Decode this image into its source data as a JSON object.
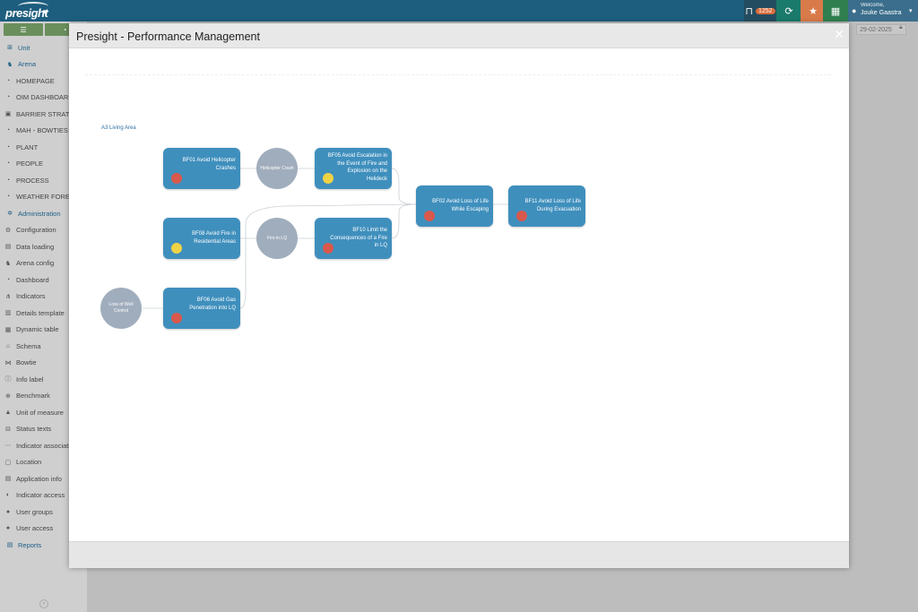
{
  "app": {
    "logo_text": "presight",
    "title": "Presight - Performance Management"
  },
  "topbar": {
    "bookmark_count": "1252",
    "user_welcome": "Welcome,",
    "user_name": "Jouke Gaastra"
  },
  "background": {
    "date": "29-02-2025"
  },
  "sidebar": {
    "items": [
      {
        "label": "Unit",
        "icon": "sitemap-icon",
        "type": "section"
      },
      {
        "label": "Arena",
        "icon": "arena-icon",
        "type": "section"
      },
      {
        "label": "HOMEPAGE",
        "icon": "dashboard-icon",
        "type": "item"
      },
      {
        "label": "OIM DASHBOARD",
        "icon": "dashboard-icon",
        "type": "item"
      },
      {
        "label": "BARRIER STRATEGY",
        "icon": "barrier-icon",
        "type": "item"
      },
      {
        "label": "MAH - BOWTIES",
        "icon": "dashboard-icon",
        "type": "item"
      },
      {
        "label": "PLANT",
        "icon": "dashboard-icon",
        "type": "item"
      },
      {
        "label": "PEOPLE",
        "icon": "dashboard-icon",
        "type": "item"
      },
      {
        "label": "PROCESS",
        "icon": "dashboard-icon",
        "type": "item"
      },
      {
        "label": "WEATHER FORECAST",
        "icon": "dashboard-icon",
        "type": "item"
      },
      {
        "label": "Administration",
        "icon": "gears-icon",
        "type": "section"
      },
      {
        "label": "Configuration",
        "icon": "gear-icon",
        "type": "item"
      },
      {
        "label": "Data loading",
        "icon": "file-icon",
        "type": "item"
      },
      {
        "label": "Arena config",
        "icon": "arena-icon",
        "type": "item"
      },
      {
        "label": "Dashboard",
        "icon": "dashboard-icon",
        "type": "item"
      },
      {
        "label": "Indicators",
        "icon": "indicator-icon",
        "type": "item"
      },
      {
        "label": "Details template",
        "icon": "template-icon",
        "type": "item"
      },
      {
        "label": "Dynamic table",
        "icon": "table-icon",
        "type": "item"
      },
      {
        "label": "Schema",
        "icon": "schema-icon",
        "type": "item"
      },
      {
        "label": "Bowtie",
        "icon": "bowtie-icon",
        "type": "item"
      },
      {
        "label": "Info label",
        "icon": "info-icon",
        "type": "item"
      },
      {
        "label": "Benchmark",
        "icon": "benchmark-icon",
        "type": "item"
      },
      {
        "label": "Unit of measure",
        "icon": "measure-icon",
        "type": "item"
      },
      {
        "label": "Status texts",
        "icon": "status-icon",
        "type": "item"
      },
      {
        "label": "Indicator associations",
        "icon": "association-icon",
        "type": "item"
      },
      {
        "label": "Location",
        "icon": "location-icon",
        "type": "item"
      },
      {
        "label": "Application info",
        "icon": "app-info-icon",
        "type": "item"
      },
      {
        "label": "Indicator access",
        "icon": "access-icon",
        "type": "item"
      },
      {
        "label": "User groups",
        "icon": "users-icon",
        "type": "item"
      },
      {
        "label": "User access",
        "icon": "user-icon",
        "type": "item"
      },
      {
        "label": "Reports",
        "icon": "reports-icon",
        "type": "section"
      }
    ]
  },
  "diagram": {
    "area_label": "A3 Living Area",
    "nodes": [
      {
        "id": "bf01",
        "label": "BF01 Avoid Helicopter Crashes",
        "status": "red"
      },
      {
        "id": "bf05",
        "label": "BF05 Avoid Escalation in the Event of Fire and Explosion on the Helideck",
        "status": "yellow"
      },
      {
        "id": "bf08",
        "label": "BF08 Avoid Fire in Residential Areas",
        "status": "yellow"
      },
      {
        "id": "bf10",
        "label": "BF10 Limit the Consequences of a Fire in LQ",
        "status": "red"
      },
      {
        "id": "bf06",
        "label": "BF06 Avoid Gas Penetration into LQ",
        "status": "red"
      },
      {
        "id": "bf02",
        "label": "BF02 Avoid Loss of Life While Escaping",
        "status": "red"
      },
      {
        "id": "bf11",
        "label": "BF11 Avoid Loss of Life During Evacuation",
        "status": "red"
      }
    ],
    "events": [
      {
        "id": "heli",
        "label": "Helicopter Crash"
      },
      {
        "id": "fire",
        "label": "Fire in LQ"
      },
      {
        "id": "well",
        "label": "Loss of Well Control"
      }
    ],
    "status_colors": {
      "red": "#d8594c",
      "yellow": "#efd347",
      "node": "#3f8fbd",
      "event": "#a0adbd"
    }
  }
}
